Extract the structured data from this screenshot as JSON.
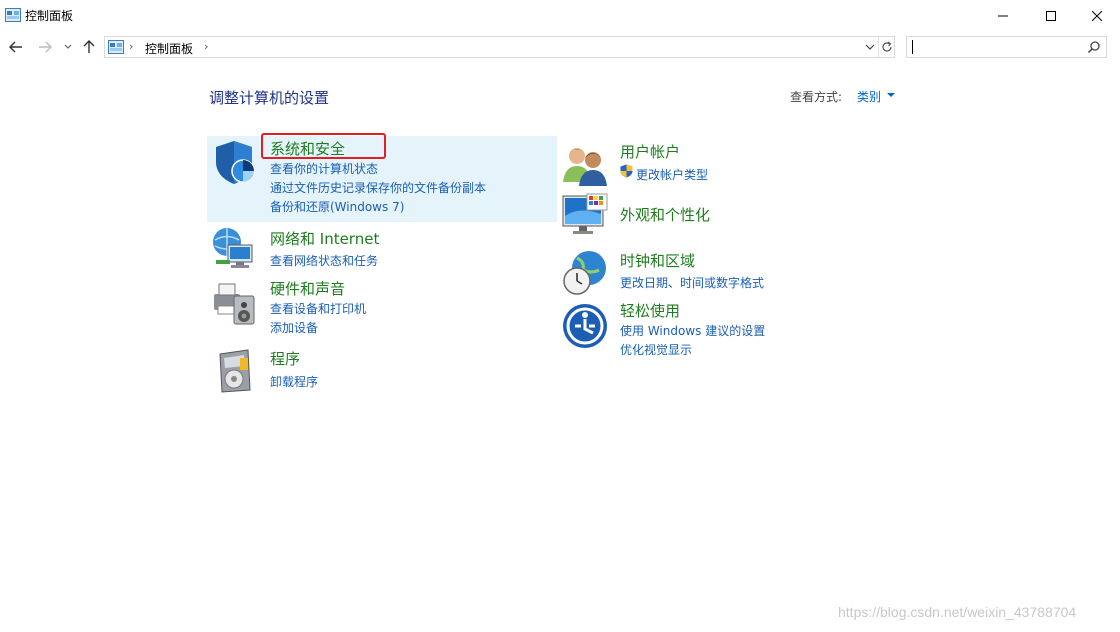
{
  "window": {
    "title": "控制面板"
  },
  "nav": {
    "breadcrumb": "控制面板",
    "separator": "›",
    "search_placeholder": ""
  },
  "main": {
    "heading": "调整计算机的设置",
    "view_by_label": "查看方式:",
    "view_by_value": "类别"
  },
  "categories": [
    {
      "title": "系统和安全",
      "icon": "shield-icon",
      "links": [
        "查看你的计算机状态",
        "通过文件历史记录保存你的文件备份副本",
        "备份和还原(Windows 7)"
      ]
    },
    {
      "title": "网络和 Internet",
      "icon": "network-icon",
      "links": [
        "查看网络状态和任务"
      ]
    },
    {
      "title": "硬件和声音",
      "icon": "printer-speaker-icon",
      "links": [
        "查看设备和打印机",
        "添加设备"
      ]
    },
    {
      "title": "程序",
      "icon": "programs-icon",
      "links": [
        "卸载程序"
      ]
    },
    {
      "title": "用户帐户",
      "icon": "users-icon",
      "links": [
        "更改帐户类型"
      ]
    },
    {
      "title": "外观和个性化",
      "icon": "monitor-palette-icon",
      "links": []
    },
    {
      "title": "时钟和区域",
      "icon": "clock-globe-icon",
      "links": [
        "更改日期、时间或数字格式"
      ]
    },
    {
      "title": "轻松使用",
      "icon": "ease-of-access-icon",
      "links": [
        "使用 Windows 建议的设置",
        "优化视觉显示"
      ]
    }
  ],
  "watermark": "https://blog.csdn.net/weixin_43788704",
  "colors": {
    "heading": "#1e3287",
    "category_title": "#1e7d1e",
    "link": "#1a5fb4",
    "hover_bg": "#e5f3fb",
    "highlight": "#e02020"
  }
}
